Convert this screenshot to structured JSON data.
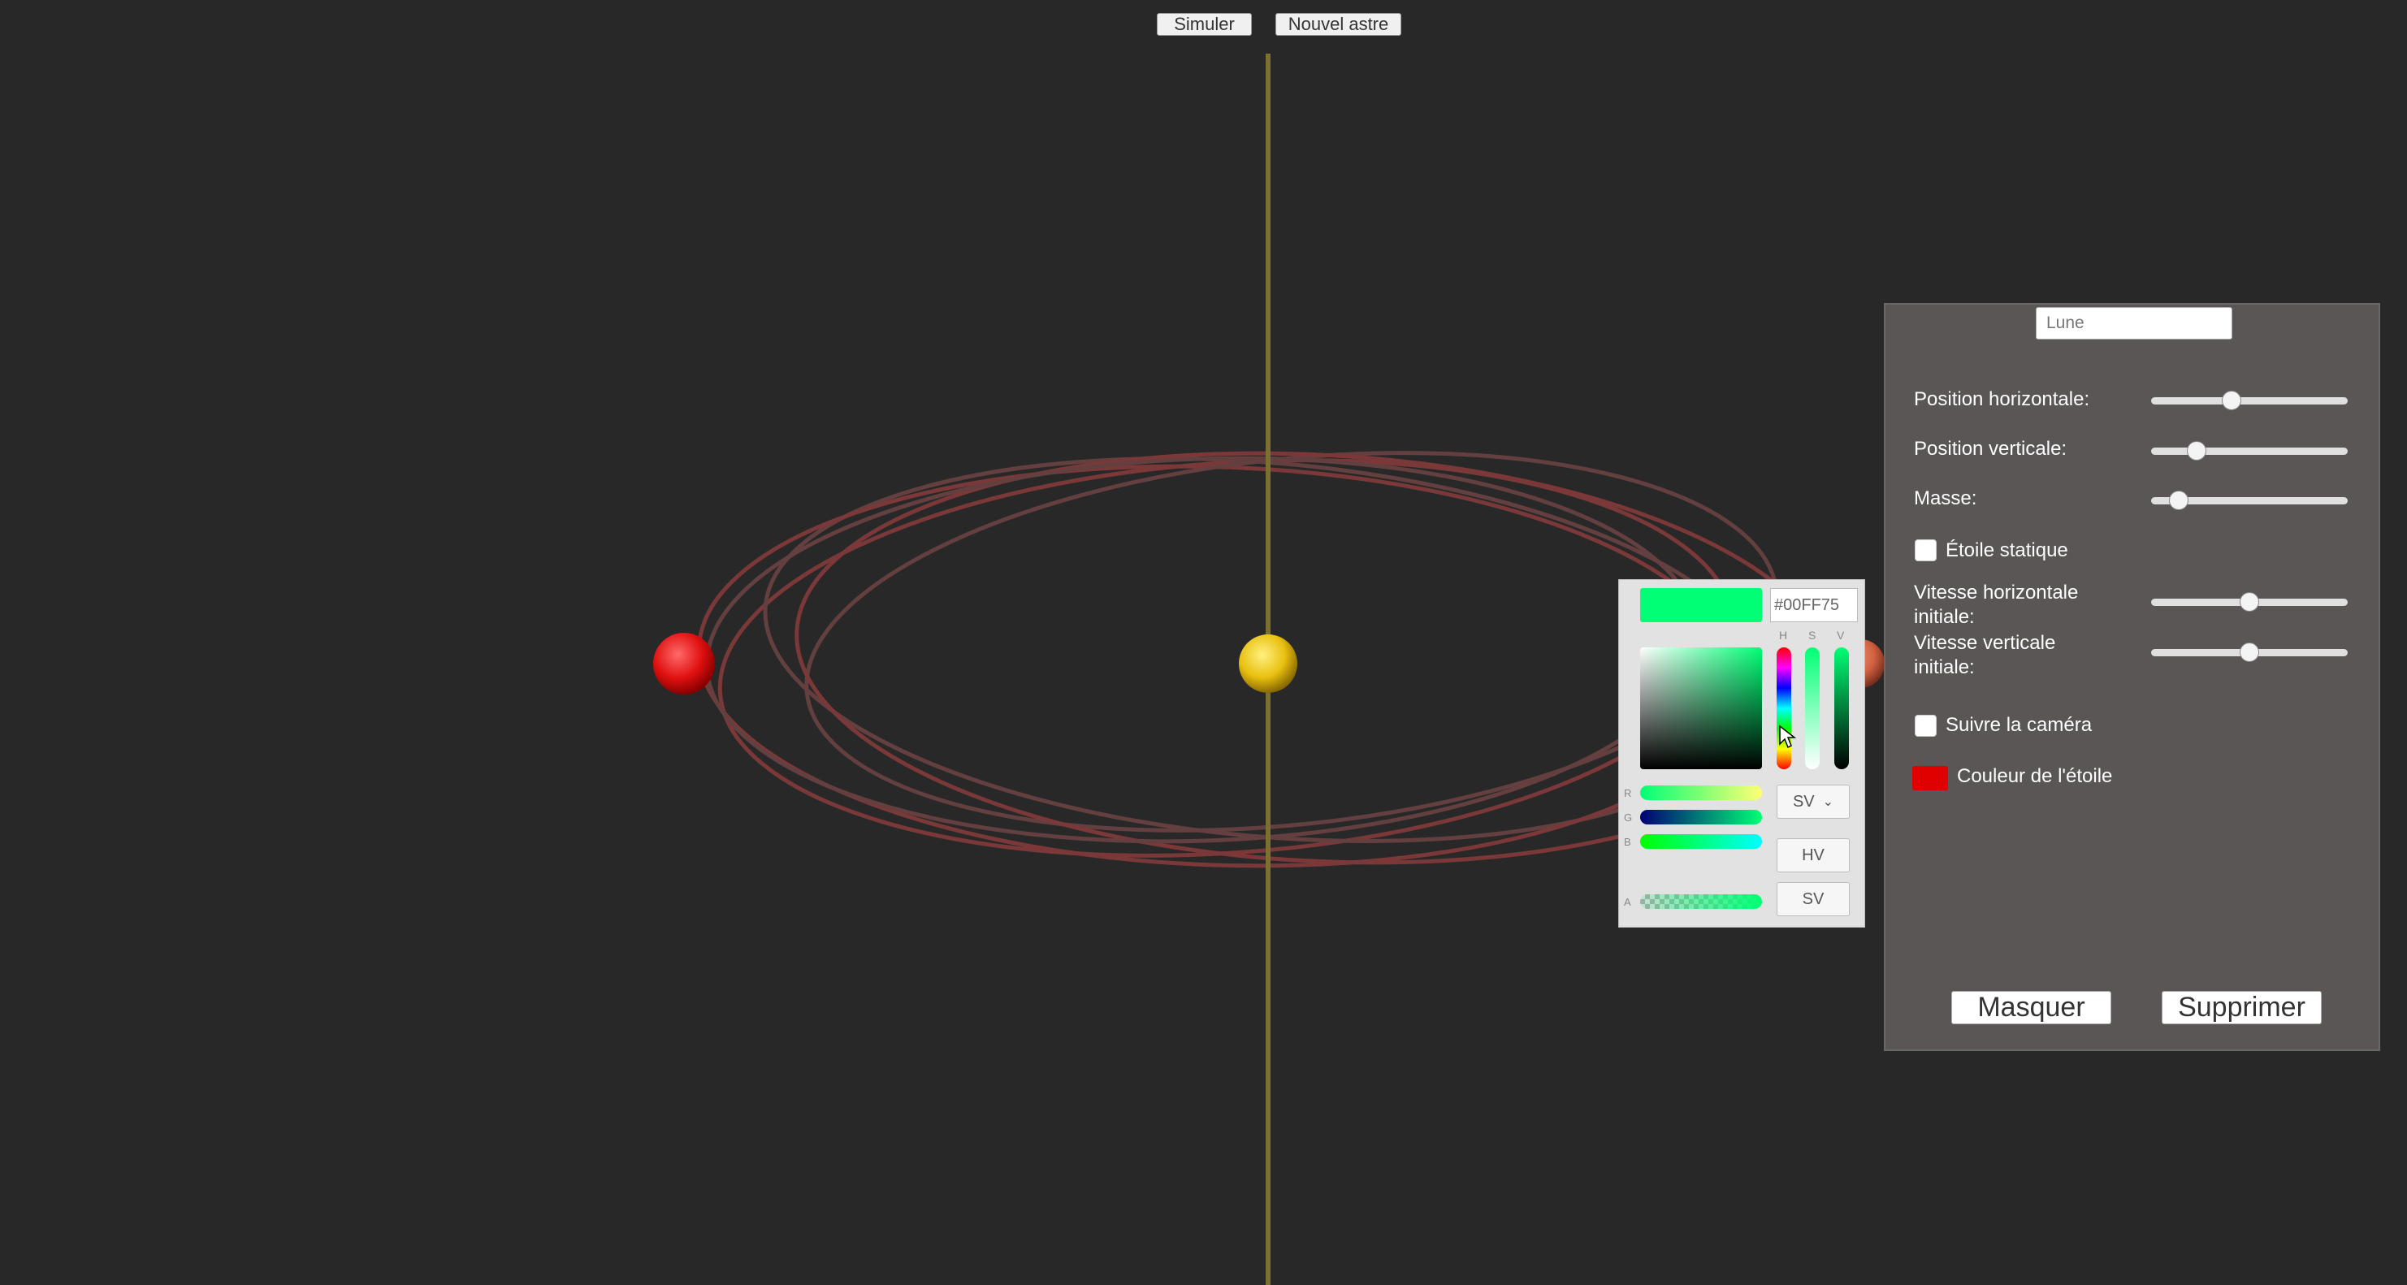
{
  "toolbar": {
    "simulate_label": "Simuler",
    "new_body_label": "Nouvel astre"
  },
  "scene": {
    "axis_color": "#7a7030",
    "bodies": [
      {
        "name": "left-planet",
        "color": "#e01010"
      },
      {
        "name": "central-star",
        "color": "#e8c010"
      },
      {
        "name": "right-planet",
        "color": "#d06040"
      }
    ],
    "orbit_color": "#8a3b3b"
  },
  "panel": {
    "name_value": "Lune",
    "position_horizontal_label": "Position horizontale:",
    "position_horizontal_value": 0.41,
    "position_vertical_label": "Position verticale:",
    "position_vertical_value": 0.23,
    "mass_label": "Masse:",
    "mass_value": 0.14,
    "static_star_label": "Étoile statique",
    "static_star_checked": false,
    "initial_h_speed_label": "Vitesse horizontale initiale:",
    "initial_h_speed_value": 0.5,
    "initial_v_speed_label": "Vitesse verticale initiale:",
    "initial_v_speed_value": 0.5,
    "follow_camera_label": "Suivre la caméra",
    "follow_camera_checked": false,
    "star_color_label": "Couleur de l'étoile",
    "star_color": "#e00000",
    "hide_label": "Masquer",
    "delete_label": "Supprimer"
  },
  "color_picker": {
    "hex_value": "#00FF75",
    "current_color": "#00ff75",
    "h_label": "H",
    "s_label": "S",
    "v_label": "V",
    "r_label": "R",
    "g_label": "G",
    "b_label": "B",
    "a_label": "A",
    "mode_select_value": "SV",
    "hv_button_label": "HV",
    "sv_button_label": "SV"
  }
}
